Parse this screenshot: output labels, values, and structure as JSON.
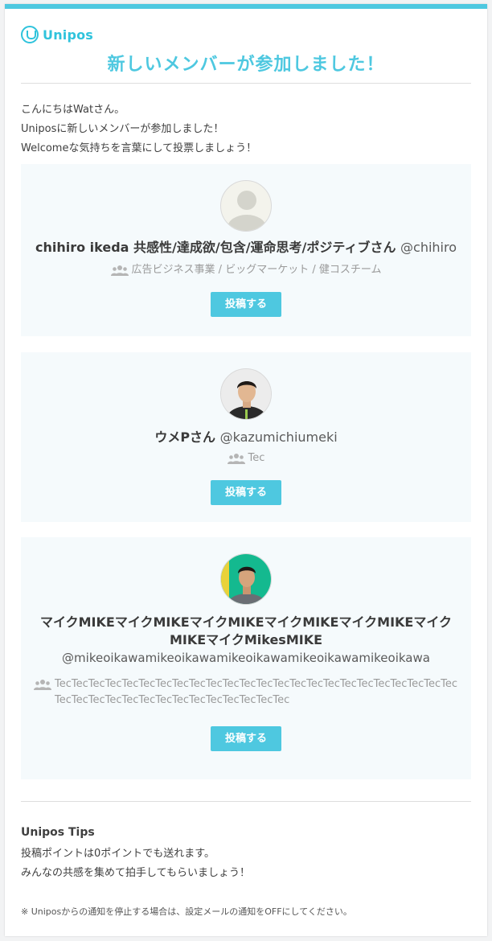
{
  "header": {
    "logo_text": "Unipos",
    "title": "新しいメンバーが参加しました！"
  },
  "intro": {
    "line1": "こんにちはWatさん。",
    "line2": "Uniposに新しいメンバーが参加しました！",
    "line3": "Welcomeな気持ちを言葉にして投票しましょう！"
  },
  "members": [
    {
      "name": "chihiro ikeda 共感性/達成欲/包含/運命思考/ポジティブさん",
      "handle": "@chihiro",
      "team": "広告ビジネス事業 / ビッグマーケット / 健コスチーム",
      "button": "投稿する",
      "avatar": "default-avatar-icon"
    },
    {
      "name": "ウメPさん",
      "handle": "@kazumichiumeki",
      "team": "Tec",
      "button": "投稿する",
      "avatar": "user-photo"
    },
    {
      "name": "マイクMIKEマイクMIKEマイクMIKEマイクMIKEマイクMIKEマイクMIKEマイクMikesMIKE",
      "handle": "@mikeoikawamikeoikawamikeoikawamikeoikawamikeoikawa",
      "team": "TecTecTecTecTecTecTecTecTecTecTecTecTecTecTecTecTecTecTecTecTecTecTecTecTecTecTecTecTecTecTecTecTecTecTecTecTecTec",
      "button": "投稿する",
      "avatar": "user-photo"
    }
  ],
  "tips": {
    "title": "Unipos Tips",
    "line1": "投稿ポイントは0ポイントでも送れます。",
    "line2": "みんなの共感を集めて拍手してもらいましょう！"
  },
  "footer": {
    "note": "※ Uniposからの通知を停止する場合は、設定メールの通知をOFFにしてください。"
  },
  "colors": {
    "accent": "#4ec8e0",
    "card_bg": "#f5fafc",
    "muted_text": "#9a9a9a"
  }
}
